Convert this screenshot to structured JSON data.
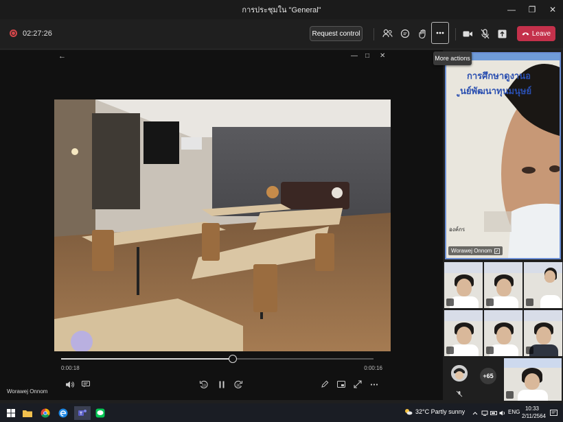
{
  "window": {
    "title": "การประชุมใน \"General\""
  },
  "toolbar": {
    "timer": "02:27:26",
    "request_control": "Request control",
    "leave": "Leave",
    "tooltip": "More actions"
  },
  "player": {
    "elapsed": "0:00:18",
    "total": "0:00:16",
    "progress": 0.55,
    "skip_back": "10",
    "skip_fwd": "30"
  },
  "presenter": {
    "name": "Worawej Onnom"
  },
  "speaker": {
    "name": "Worawej Onnom",
    "slide_line1": "การศึกษาดูงานอ",
    "slide_line2": "ูนย์พัฒนาทุนมนุษย์",
    "slide_small": "องค์กร"
  },
  "participants": {
    "overflow_count": "+65"
  },
  "taskbar": {
    "weather": "32°C  Partly sunny",
    "language": "ENG",
    "time": "10:33",
    "date": "2/11/2564"
  },
  "colors": {
    "leave": "#c4314b",
    "accent": "#6b8fd6"
  }
}
